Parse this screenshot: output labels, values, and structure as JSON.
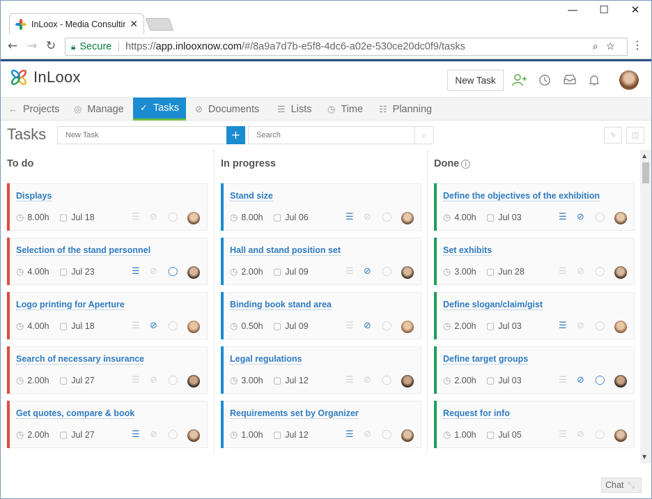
{
  "browser": {
    "tab_title": "InLoox - Media Consulting",
    "secure_label": "Secure",
    "url_scheme": "https://",
    "url_host": "app.inlooxnow.com",
    "url_path": "/#/8a9a7d7b-e5f8-4dc6-a02e-530ce20dc0f9/tasks"
  },
  "header": {
    "logo_text": "InLoox",
    "new_task_button": "New Task"
  },
  "nav": {
    "items": [
      {
        "label": "Projects",
        "icon": "arrow-left-icon"
      },
      {
        "label": "Manage",
        "icon": "target-icon"
      },
      {
        "label": "Tasks",
        "icon": "check-icon",
        "active": true
      },
      {
        "label": "Documents",
        "icon": "paperclip-icon"
      },
      {
        "label": "Lists",
        "icon": "list-icon"
      },
      {
        "label": "Time",
        "icon": "clock-icon"
      },
      {
        "label": "Planning",
        "icon": "planning-icon"
      }
    ]
  },
  "toolbar": {
    "title": "Tasks",
    "new_task_placeholder": "New Task",
    "search_placeholder": "Search"
  },
  "columns": [
    {
      "title": "To do",
      "color": "#e04b3b",
      "cards": [
        {
          "title": "Displays",
          "hours": "8.00h",
          "date": "Jul 18",
          "list": false,
          "clip": false,
          "comment": false
        },
        {
          "title": "Selection of the stand personnel",
          "hours": "4.00h",
          "date": "Jul 23",
          "list": true,
          "clip": false,
          "comment": true
        },
        {
          "title": "Logo printing for Aperture",
          "hours": "4.00h",
          "date": "Jul 18",
          "list": false,
          "clip": true,
          "comment": false
        },
        {
          "title": "Search of necessary insurance",
          "hours": "2.00h",
          "date": "Jul 27",
          "list": false,
          "clip": false,
          "comment": false
        },
        {
          "title": "Get quotes, compare & book",
          "hours": "2.00h",
          "date": "Jul 27",
          "list": true,
          "clip": false,
          "comment": false
        }
      ]
    },
    {
      "title": "In progress",
      "color": "#1b8cd0",
      "cards": [
        {
          "title": "Stand size",
          "hours": "8.00h",
          "date": "Jul 06",
          "list": true,
          "clip": false,
          "comment": false
        },
        {
          "title": "Hall and stand position set",
          "hours": "2.00h",
          "date": "Jul 09",
          "list": false,
          "clip": true,
          "comment": false
        },
        {
          "title": "Binding book stand area",
          "hours": "0.50h",
          "date": "Jul 09",
          "list": false,
          "clip": true,
          "comment": false
        },
        {
          "title": "Legal regulations",
          "hours": "3.00h",
          "date": "Jul 12",
          "list": false,
          "clip": false,
          "comment": false
        },
        {
          "title": "Requirements set by Organizer",
          "hours": "1.00h",
          "date": "Jul 12",
          "list": true,
          "clip": false,
          "comment": false
        }
      ]
    },
    {
      "title": "Done",
      "color": "#1f9e5a",
      "cards": [
        {
          "title": "Define the objectives of the exhibition",
          "hours": "4.00h",
          "date": "Jul 03",
          "list": true,
          "clip": true,
          "comment": false
        },
        {
          "title": "Set exhibits",
          "hours": "3.00h",
          "date": "Jun 28",
          "list": false,
          "clip": false,
          "comment": false
        },
        {
          "title": "Define slogan/claim/gist",
          "hours": "2.00h",
          "date": "Jul 03",
          "list": true,
          "clip": false,
          "comment": false
        },
        {
          "title": "Define target groups",
          "hours": "2.00h",
          "date": "Jul 03",
          "list": false,
          "clip": true,
          "comment": true
        },
        {
          "title": "Request for info",
          "hours": "1.00h",
          "date": "Jul 05",
          "list": false,
          "clip": false,
          "comment": false
        }
      ]
    }
  ],
  "chat_label": "Chat"
}
